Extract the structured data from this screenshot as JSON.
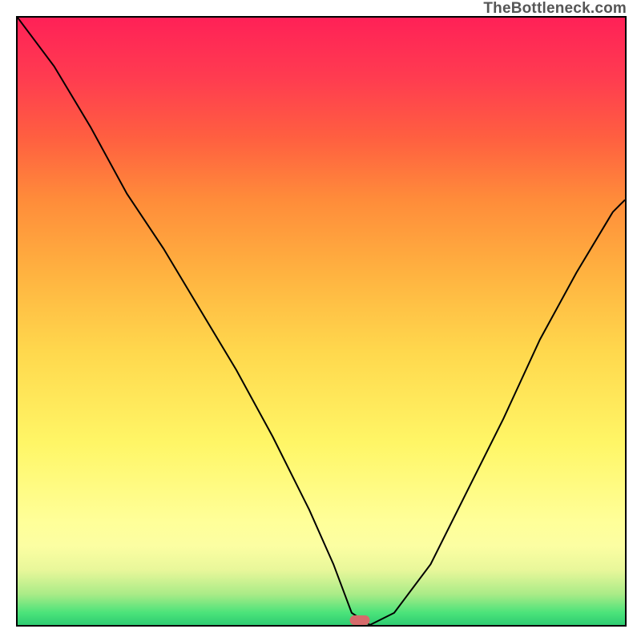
{
  "attribution": "TheBottleneck.com",
  "chart_data": {
    "type": "line",
    "title": "",
    "xlabel": "",
    "ylabel": "",
    "xlim": [
      0,
      100
    ],
    "ylim": [
      0,
      100
    ],
    "grid": false,
    "legend": false,
    "annotations": [],
    "series": [
      {
        "name": "curve",
        "x": [
          0,
          6,
          12,
          18,
          24,
          30,
          36,
          42,
          48,
          52,
          55,
          58,
          62,
          68,
          74,
          80,
          86,
          92,
          98,
          100
        ],
        "values": [
          100,
          92,
          82,
          71,
          62,
          52,
          42,
          31,
          19,
          10,
          2,
          0,
          2,
          10,
          22,
          34,
          47,
          58,
          68,
          70
        ]
      }
    ],
    "markers": [
      {
        "x": 56.3,
        "y": 0.8,
        "color": "#d66b6b",
        "shape": "pill"
      }
    ],
    "background_gradient": {
      "direction": "vertical",
      "stops": [
        {
          "pos": 0,
          "color": "#ff2157"
        },
        {
          "pos": 0.5,
          "color": "#ffd84d"
        },
        {
          "pos": 0.87,
          "color": "#fcfea2"
        },
        {
          "pos": 1,
          "color": "#2ecc71"
        }
      ]
    }
  }
}
